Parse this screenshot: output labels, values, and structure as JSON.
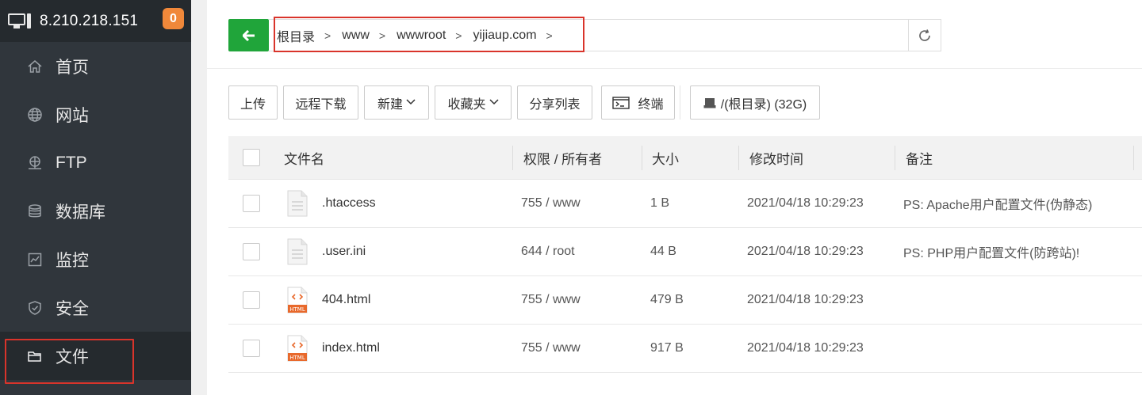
{
  "sidebar": {
    "server_ip": "8.210.218.151",
    "badge_count": "0",
    "items": [
      {
        "label": "首页",
        "icon": "home-icon"
      },
      {
        "label": "网站",
        "icon": "globe-icon"
      },
      {
        "label": "FTP",
        "icon": "ftp-icon"
      },
      {
        "label": "数据库",
        "icon": "database-icon"
      },
      {
        "label": "监控",
        "icon": "monitor-icon"
      },
      {
        "label": "安全",
        "icon": "shield-icon"
      },
      {
        "label": "文件",
        "icon": "folder-icon",
        "active": true
      }
    ]
  },
  "path": {
    "crumbs": [
      "根目录",
      "www",
      "wwwroot",
      "yijiaup.com"
    ]
  },
  "toolbar": {
    "upload": "上传",
    "remote_download": "远程下载",
    "new": "新建",
    "favorites": "收藏夹",
    "share_list": "分享列表",
    "terminal": "终端",
    "disk": "/(根目录) (32G)"
  },
  "table": {
    "headers": {
      "name": "文件名",
      "permission": "权限 / 所有者",
      "size": "大小",
      "modified": "修改时间",
      "note": "备注"
    },
    "rows": [
      {
        "name": ".htaccess",
        "type": "text",
        "permission": "755 / www",
        "size": "1 B",
        "modified": "2021/04/18 10:29:23",
        "note": "PS: Apache用户配置文件(伪静态)"
      },
      {
        "name": ".user.ini",
        "type": "text",
        "permission": "644 / root",
        "size": "44 B",
        "modified": "2021/04/18 10:29:23",
        "note": "PS: PHP用户配置文件(防跨站)!"
      },
      {
        "name": "404.html",
        "type": "html",
        "permission": "755 / www",
        "size": "479 B",
        "modified": "2021/04/18 10:29:23",
        "note": ""
      },
      {
        "name": "index.html",
        "type": "html",
        "permission": "755 / www",
        "size": "917 B",
        "modified": "2021/04/18 10:29:23",
        "note": ""
      }
    ]
  },
  "colors": {
    "sidebar_bg": "#30363c",
    "accent_green": "#20a53a",
    "badge_orange": "#f0883a",
    "highlight_red": "#d9342b"
  }
}
